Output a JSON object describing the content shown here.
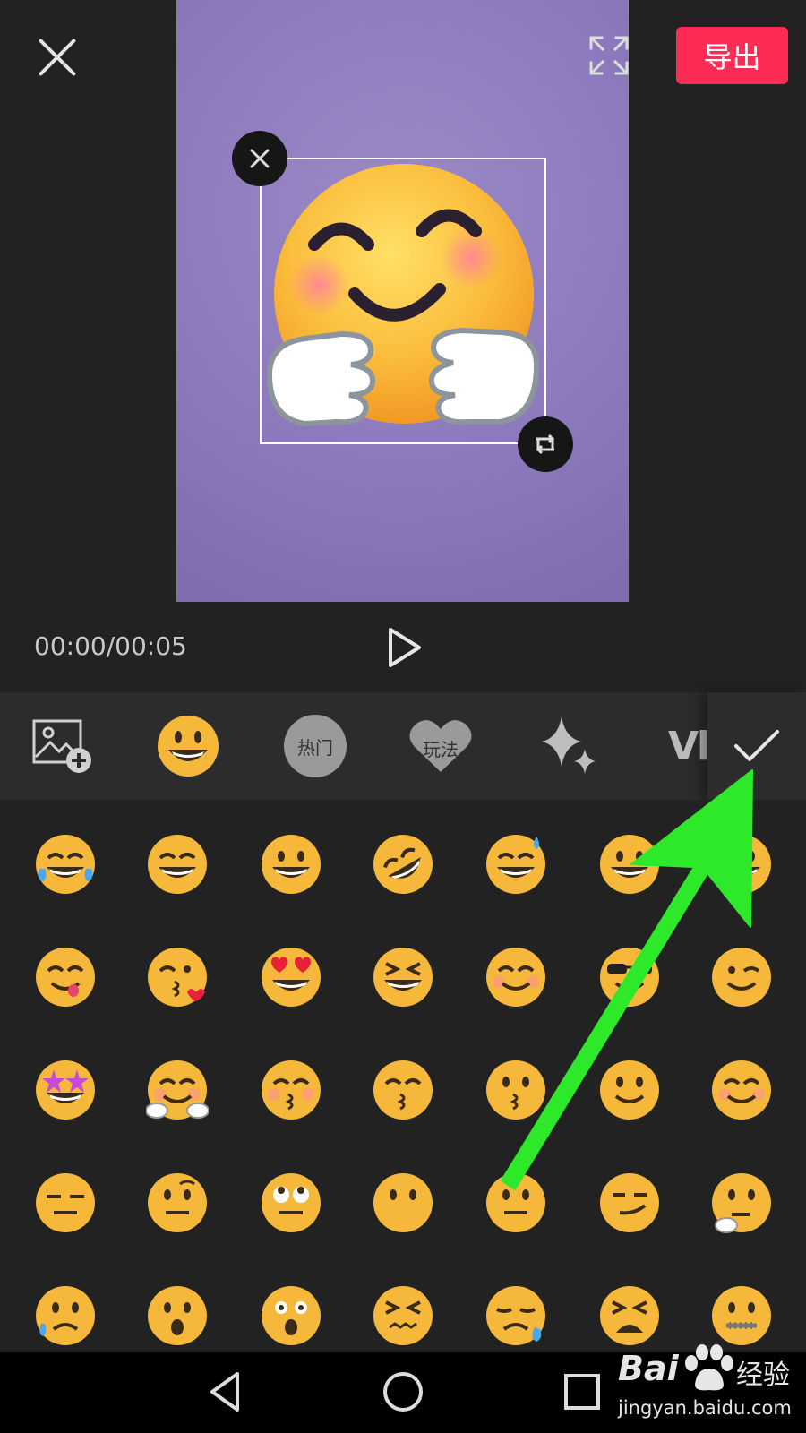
{
  "header": {
    "export_label": "导出"
  },
  "player": {
    "time": "00:00/00:05"
  },
  "tabs": [
    {
      "name": "add-image",
      "icon": "image-plus-icon"
    },
    {
      "name": "emoji",
      "icon": "grinning-face-icon"
    },
    {
      "name": "hot",
      "label": "热门",
      "icon": "flame-icon"
    },
    {
      "name": "play",
      "label": "玩法",
      "icon": "heart-icon"
    },
    {
      "name": "sparkle",
      "icon": "sparkle-icon"
    },
    {
      "name": "vlog",
      "label": "Vl"
    }
  ],
  "confirm_icon": "check-icon",
  "watermark": {
    "brand": "Bai",
    "brand_cn": "经验",
    "url": "jingyan.baidu.com"
  },
  "colors": {
    "accent": "#fe2c55",
    "arrow": "#2ee82a",
    "emoji": "#f6b83a"
  },
  "emoji_rows": [
    [
      "tears-of-joy",
      "beaming-grin",
      "grinning",
      "rolling-laughing",
      "sweat-smile",
      "grin",
      "grinning-big-eyes"
    ],
    [
      "yum",
      "kissing-heart",
      "heart-eyes",
      "laughing-squint",
      "smiling-blush",
      "sunglasses",
      "wink"
    ],
    [
      "star-struck",
      "hugging",
      "kissing-closed-eyes",
      "kissing-smiling-eyes",
      "kissing",
      "slight-smile",
      "relaxed"
    ],
    [
      "expressionless",
      "raised-eyebrow",
      "rolling-eyes",
      "no-mouth",
      "neutral",
      "smirk",
      "thinking"
    ],
    [
      "sad-sweat",
      "hushed",
      "astonished",
      "confounded",
      "sleepy",
      "tired",
      "zipper-mouth"
    ]
  ]
}
